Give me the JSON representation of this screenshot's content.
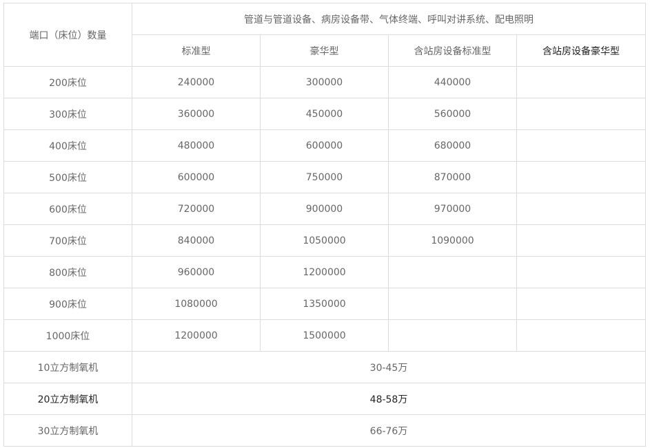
{
  "header": {
    "port_label": "端口（床位）数量",
    "group_label": "管道与管道设备、病房设备带、气体终端、呼叫对讲系统、配电照明",
    "columns": [
      "标准型",
      "豪华型",
      "含站房设备标准型",
      "含站房设备豪华型"
    ]
  },
  "rows": [
    {
      "label": "200床位",
      "values": [
        "240000",
        "300000",
        "440000",
        ""
      ]
    },
    {
      "label": "300床位",
      "values": [
        "360000",
        "450000",
        "560000",
        ""
      ]
    },
    {
      "label": "400床位",
      "values": [
        "480000",
        "600000",
        "680000",
        ""
      ]
    },
    {
      "label": "500床位",
      "values": [
        "600000",
        "750000",
        "870000",
        ""
      ]
    },
    {
      "label": "600床位",
      "values": [
        "720000",
        "900000",
        "970000",
        ""
      ]
    },
    {
      "label": "700床位",
      "values": [
        "840000",
        "1050000",
        "1090000",
        ""
      ]
    },
    {
      "label": "800床位",
      "values": [
        "960000",
        "1200000",
        "",
        ""
      ]
    },
    {
      "label": "900床位",
      "values": [
        "1080000",
        "1350000",
        "",
        ""
      ]
    },
    {
      "label": "1000床位",
      "values": [
        "1200000",
        "1500000",
        "",
        ""
      ]
    }
  ],
  "oxygen_rows": [
    {
      "label": "10立方制氧机",
      "price": "30-45万"
    },
    {
      "label": "20立方制氧机",
      "price": "48-58万"
    },
    {
      "label": "30立方制氧机",
      "price": "66-76万"
    }
  ]
}
